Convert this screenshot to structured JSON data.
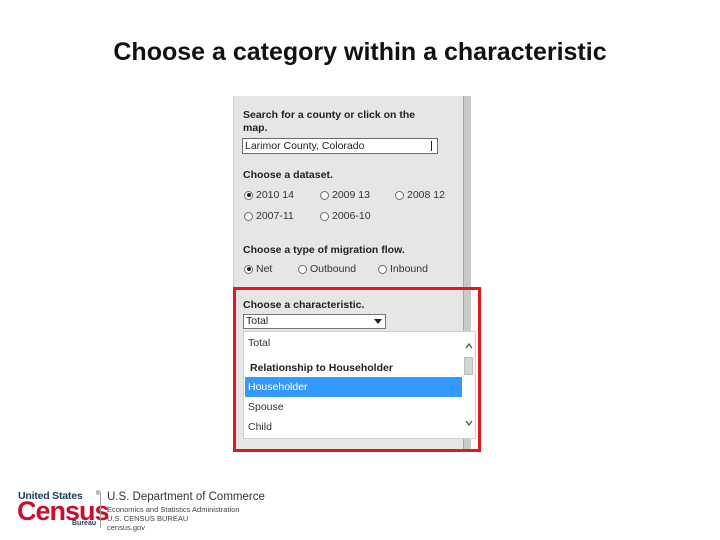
{
  "slide": {
    "title": "Choose a category within a characteristic"
  },
  "panel": {
    "search_label": "Search for a county or click on the map.",
    "search_label_line1": "Search for a county or click on the",
    "search_label_line2": "map.",
    "county_value": "Larimor County, Colorado",
    "dataset_label": "Choose a dataset.",
    "datasets": [
      {
        "label": "2010 14",
        "selected": true
      },
      {
        "label": "2009 13",
        "selected": false
      },
      {
        "label": "2008 12",
        "selected": false
      },
      {
        "label": "2007-11",
        "selected": false
      },
      {
        "label": "2006-10",
        "selected": false
      }
    ],
    "flow_label": "Choose a type of migration flow.",
    "flows": [
      {
        "label": "Net",
        "selected": true
      },
      {
        "label": "Outbound",
        "selected": false
      },
      {
        "label": "Inbound",
        "selected": false
      }
    ],
    "characteristic_label": "Choose a characteristic.",
    "characteristic_value": "Total",
    "options": [
      {
        "label": "Total",
        "type": "option",
        "selected": false
      },
      {
        "label": "Relationship to Householder",
        "type": "group",
        "selected": false
      },
      {
        "label": "Householder",
        "type": "option",
        "selected": true
      },
      {
        "label": "Spouse",
        "type": "option",
        "selected": false
      },
      {
        "label": "Child",
        "type": "option",
        "selected": false
      }
    ]
  },
  "highlight_color": "#e0191c",
  "selection_color": "#3399ff",
  "footer": {
    "logo_line1": "United States",
    "logo_tm": "®",
    "logo_line2": "Census",
    "logo_line3": "Bureau",
    "dept_title": "U.S. Department of Commerce",
    "dept_line1": "Economics and Statistics Administration",
    "dept_line2": "U.S. CENSUS BUREAU",
    "dept_line3": "census.gov"
  }
}
